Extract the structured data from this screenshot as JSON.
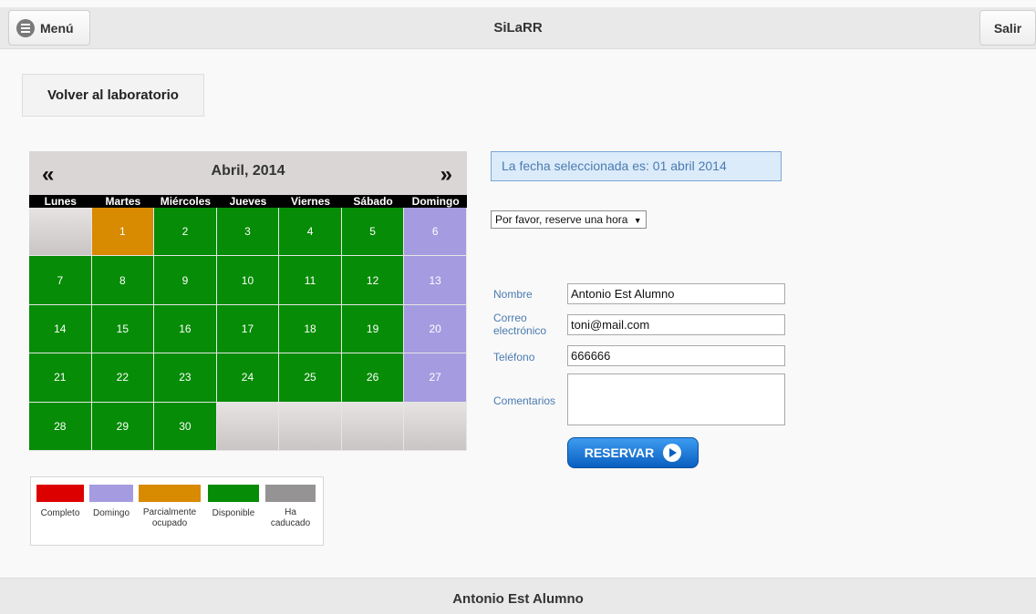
{
  "header": {
    "menu_label": "Menú",
    "title": "SiLaRR",
    "logout_label": "Salir"
  },
  "back_button": "Volver al laboratorio",
  "calendar": {
    "month_label": "Abril, 2014",
    "prev": "«",
    "next": "»",
    "weekdays": [
      "Lunes",
      "Martes",
      "Miércoles",
      "Jueves",
      "Viernes",
      "Sábado",
      "Domingo"
    ],
    "cells": [
      {
        "day": "",
        "status": "empty"
      },
      {
        "day": "1",
        "status": "partial"
      },
      {
        "day": "2",
        "status": "available"
      },
      {
        "day": "3",
        "status": "available"
      },
      {
        "day": "4",
        "status": "available"
      },
      {
        "day": "5",
        "status": "available"
      },
      {
        "day": "6",
        "status": "sunday"
      },
      {
        "day": "7",
        "status": "available"
      },
      {
        "day": "8",
        "status": "available"
      },
      {
        "day": "9",
        "status": "available"
      },
      {
        "day": "10",
        "status": "available"
      },
      {
        "day": "11",
        "status": "available"
      },
      {
        "day": "12",
        "status": "available"
      },
      {
        "day": "13",
        "status": "sunday"
      },
      {
        "day": "14",
        "status": "available"
      },
      {
        "day": "15",
        "status": "available"
      },
      {
        "day": "16",
        "status": "available"
      },
      {
        "day": "17",
        "status": "available"
      },
      {
        "day": "18",
        "status": "available"
      },
      {
        "day": "19",
        "status": "available"
      },
      {
        "day": "20",
        "status": "sunday"
      },
      {
        "day": "21",
        "status": "available"
      },
      {
        "day": "22",
        "status": "available"
      },
      {
        "day": "23",
        "status": "available"
      },
      {
        "day": "24",
        "status": "available"
      },
      {
        "day": "25",
        "status": "available"
      },
      {
        "day": "26",
        "status": "available"
      },
      {
        "day": "27",
        "status": "sunday"
      },
      {
        "day": "28",
        "status": "available"
      },
      {
        "day": "29",
        "status": "available"
      },
      {
        "day": "30",
        "status": "available"
      },
      {
        "day": "",
        "status": "empty"
      },
      {
        "day": "",
        "status": "empty"
      },
      {
        "day": "",
        "status": "empty"
      },
      {
        "day": "",
        "status": "empty"
      }
    ]
  },
  "legend": [
    {
      "label": "Completo",
      "color": "#dd0000"
    },
    {
      "label": "Domingo",
      "color": "#a49be0"
    },
    {
      "label": "Parcialmente ocupado",
      "color": "#d88a00"
    },
    {
      "label": "Disponible",
      "color": "#068c06"
    },
    {
      "label": "Ha caducado",
      "color": "#959393"
    }
  ],
  "selected_date": "La fecha seleccionada es: 01 abril 2014",
  "hour_select": "Por favor, reserve una hora",
  "form": {
    "name_label": "Nombre",
    "name_value": "Antonio Est Alumno",
    "email_label": "Correo electrónico",
    "email_value": "toni@mail.com",
    "phone_label": "Teléfono",
    "phone_value": "666666",
    "comments_label": "Comentarios",
    "comments_value": ""
  },
  "submit_label": "RESERVAR",
  "footer_user": "Antonio Est Alumno"
}
